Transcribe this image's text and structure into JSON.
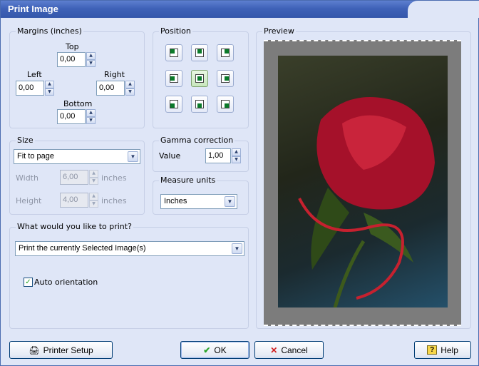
{
  "window": {
    "title": "Print Image"
  },
  "margins": {
    "label": "Margins (inches)",
    "top_label": "Top",
    "top_value": "0,00",
    "left_label": "Left",
    "left_value": "0,00",
    "right_label": "Right",
    "right_value": "0,00",
    "bottom_label": "Bottom",
    "bottom_value": "0,00"
  },
  "position": {
    "label": "Position",
    "selected": "center"
  },
  "size": {
    "label": "Size",
    "mode": "Fit to page",
    "width_label": "Width",
    "width_value": "6,00",
    "width_unit": "inches",
    "height_label": "Height",
    "height_value": "4,00",
    "height_unit": "inches"
  },
  "gamma": {
    "label": "Gamma correction",
    "value_label": "Value",
    "value": "1,00"
  },
  "measure": {
    "label": "Measure units",
    "value": "Inches"
  },
  "print_what": {
    "label": "What would you like to print?",
    "value": "Print the currently Selected Image(s)",
    "auto_orientation_label": "Auto orientation",
    "auto_orientation_checked": true
  },
  "preview": {
    "label": "Preview"
  },
  "buttons": {
    "printer_setup": "Printer Setup",
    "ok": "OK",
    "cancel": "Cancel",
    "help": "Help"
  },
  "colors": {
    "title_bar": "#3f62b8",
    "window_bg": "#dfe6f7",
    "position_dot": "#0b7a2a"
  }
}
